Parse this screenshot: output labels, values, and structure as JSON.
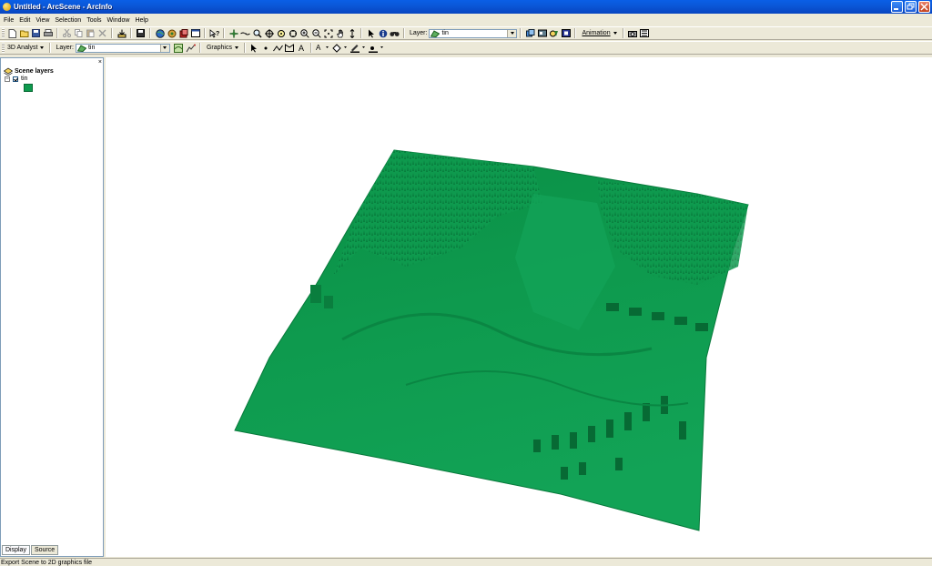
{
  "window": {
    "title": "Untitled - ArcScene - ArcInfo"
  },
  "menu": [
    "File",
    "Edit",
    "View",
    "Selection",
    "Tools",
    "Window",
    "Help"
  ],
  "toolbar1": {
    "layer_label": "Layer:",
    "layer_value": "tin",
    "animation_label": "Animation"
  },
  "toolbar2": {
    "analyst_label": "3D Analyst",
    "layer_label": "Layer:",
    "layer_value": "tin",
    "graphics_label": "Graphics"
  },
  "toc": {
    "root_label": "Scene layers",
    "layer_name": "tin",
    "tabs": [
      "Display",
      "Source"
    ],
    "swatch_color": "#0E9A4E"
  },
  "scene": {
    "terrain_color": "#0E9A4E",
    "background": "#FFFFFF"
  },
  "status": {
    "text": "Export Scene to 2D graphics file"
  }
}
